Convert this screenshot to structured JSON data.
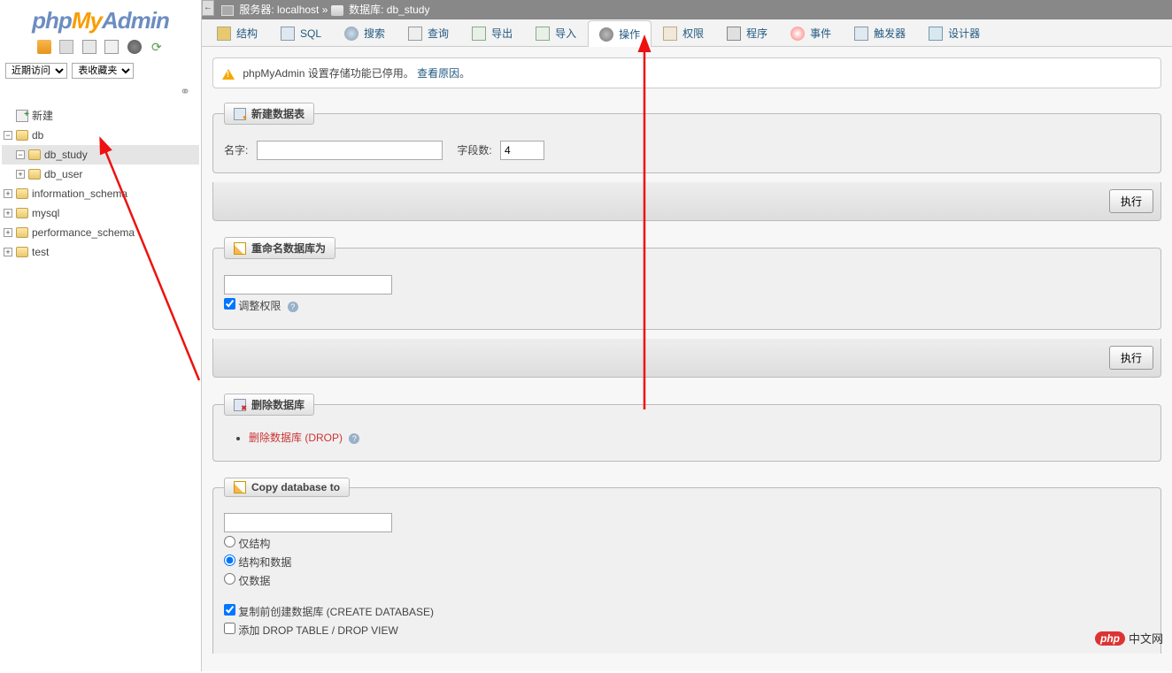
{
  "logo": {
    "p1": "php",
    "p2": "My",
    "p3": "Admin"
  },
  "sidebar": {
    "recent": "近期访问",
    "favorites": "表收藏夹",
    "new": "新建",
    "dbs": [
      "db",
      "db_study",
      "db_user",
      "information_schema",
      "mysql",
      "performance_schema",
      "test"
    ]
  },
  "breadcrumb": {
    "server_label": "服务器: ",
    "server": "localhost",
    "sep": " » ",
    "db_label": "数据库: ",
    "db": "db_study"
  },
  "tabs": {
    "structure": "结构",
    "sql": "SQL",
    "search": "搜索",
    "query": "查询",
    "export": "导出",
    "import": "导入",
    "operations": "操作",
    "privileges": "权限",
    "routines": "程序",
    "events": "事件",
    "triggers": "触发器",
    "designer": "设计器"
  },
  "notice": {
    "text": "phpMyAdmin 设置存储功能已停用。",
    "link": "查看原因",
    "tail": "。"
  },
  "newtable": {
    "legend": "新建数据表",
    "name_label": "名字:",
    "cols_label": "字段数:",
    "cols_value": "4",
    "submit": "执行"
  },
  "rename": {
    "legend": "重命名数据库为",
    "adjust": "调整权限",
    "submit": "执行"
  },
  "drop": {
    "legend": "删除数据库",
    "link": "删除数据库 (DROP)"
  },
  "copy": {
    "legend": "Copy database to",
    "opt_struct": "仅结构",
    "opt_both": "结构和数据",
    "opt_data": "仅数据",
    "create_before": "复制前创建数据库 (CREATE DATABASE)",
    "add_drop": "添加 DROP TABLE / DROP VIEW"
  },
  "watermark": {
    "badge": "php",
    "text": "中文网"
  }
}
